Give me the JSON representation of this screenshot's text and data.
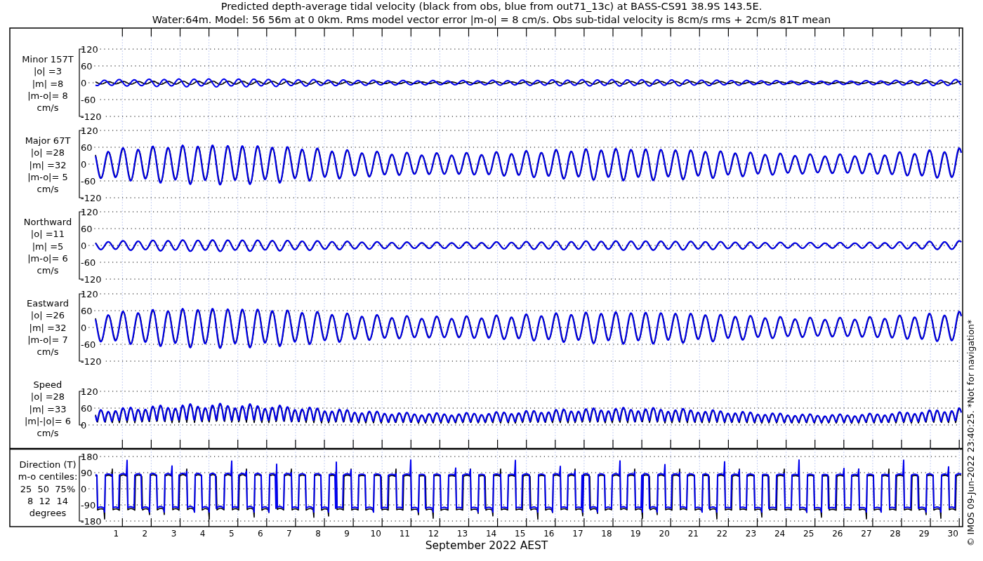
{
  "title_lines": [
    "Predicted depth-average tidal velocity (black from obs, blue from out71_13c) at BASS-CS91 38.9S 143.5E.",
    "Water:64m. Model: 56 56m at 0 0km. Rms model vector error |m-o| = 8 cm/s. Obs sub-tidal velocity is 8cm/s rms + 2cm/s 81T mean"
  ],
  "panels": [
    {
      "kind": "velocity",
      "label_lines": [
        "Minor 157T",
        "|o| =3",
        "|m| =8",
        "|m-o|= 8",
        "cm/s"
      ],
      "yticks": [
        "120",
        "60",
        "0",
        "-60",
        "-120"
      ]
    },
    {
      "kind": "velocity",
      "label_lines": [
        "Major 67T",
        "|o| =28",
        "|m| =32",
        "|m-o|= 5",
        "cm/s"
      ],
      "yticks": [
        "120",
        "60",
        "0",
        "-60",
        "-120"
      ]
    },
    {
      "kind": "velocity",
      "label_lines": [
        "Northward",
        "|o| =11",
        "|m| =5",
        "|m-o|= 6",
        "cm/s"
      ],
      "yticks": [
        "120",
        "60",
        "0",
        "-60",
        "-120"
      ]
    },
    {
      "kind": "velocity",
      "label_lines": [
        "Eastward",
        "|o| =26",
        "|m| =32",
        "|m-o|= 7",
        "cm/s"
      ],
      "yticks": [
        "120",
        "60",
        "0",
        "-60",
        "-120"
      ]
    },
    {
      "kind": "speed",
      "label_lines": [
        "Speed",
        "|o| =28",
        "|m| =33",
        "|m|-|o|= 6",
        "cm/s"
      ],
      "yticks": [
        "120",
        "60",
        "0"
      ]
    },
    {
      "kind": "direction",
      "label_lines": [
        "Direction (T)",
        "m-o centiles:",
        "25  50  75%",
        "8  12  14",
        "degrees"
      ],
      "yticks": [
        "180",
        "90",
        "0",
        "-90",
        "-180"
      ]
    }
  ],
  "x_axis": {
    "day_labels": [
      "1",
      "2",
      "3",
      "4",
      "5",
      "6",
      "7",
      "8",
      "9",
      "10",
      "11",
      "12",
      "13",
      "14",
      "15",
      "16",
      "17",
      "18",
      "19",
      "20",
      "21",
      "22",
      "23",
      "24",
      "25",
      "26",
      "27",
      "28",
      "29",
      "30"
    ],
    "label": "September 2022 AEST"
  },
  "footer": "© IMOS 09-Jun-2022 23:40:25. *Not for navigation*"
}
